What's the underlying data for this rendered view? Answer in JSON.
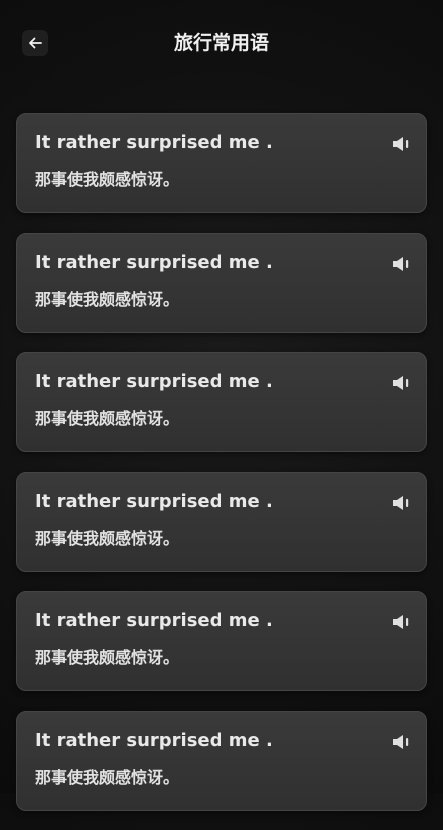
{
  "header": {
    "title": "旅行常用语",
    "back_icon": "arrow-left-icon"
  },
  "phrases": [
    {
      "english": "It rather surprised me .",
      "chinese": "那事使我颇感惊讶。",
      "icon": "speaker-icon"
    },
    {
      "english": "It rather surprised me .",
      "chinese": "那事使我颇感惊讶。",
      "icon": "speaker-icon"
    },
    {
      "english": "It rather surprised me .",
      "chinese": "那事使我颇感惊讶。",
      "icon": "speaker-icon"
    },
    {
      "english": "It rather surprised me .",
      "chinese": "那事使我颇感惊讶。",
      "icon": "speaker-icon"
    },
    {
      "english": "It rather surprised me .",
      "chinese": "那事使我颇感惊讶。",
      "icon": "speaker-icon"
    },
    {
      "english": "It rather surprised me .",
      "chinese": "那事使我颇感惊讶。",
      "icon": "speaker-icon"
    }
  ],
  "colors": {
    "background": "#111111",
    "card": "#353535",
    "text": "#e9e9e9"
  }
}
